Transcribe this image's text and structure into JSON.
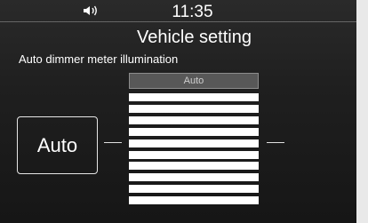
{
  "statusbar": {
    "time": "11:35",
    "volume_icon": "speaker-icon"
  },
  "page": {
    "title": "Vehicle setting",
    "subtitle": "Auto dimmer meter illumination"
  },
  "auto_button": {
    "label": "Auto"
  },
  "slider": {
    "header_label": "Auto",
    "bar_count": 10
  },
  "colors": {
    "background": "#1f1f1f",
    "text": "#ffffff",
    "header_box": "#585858"
  }
}
